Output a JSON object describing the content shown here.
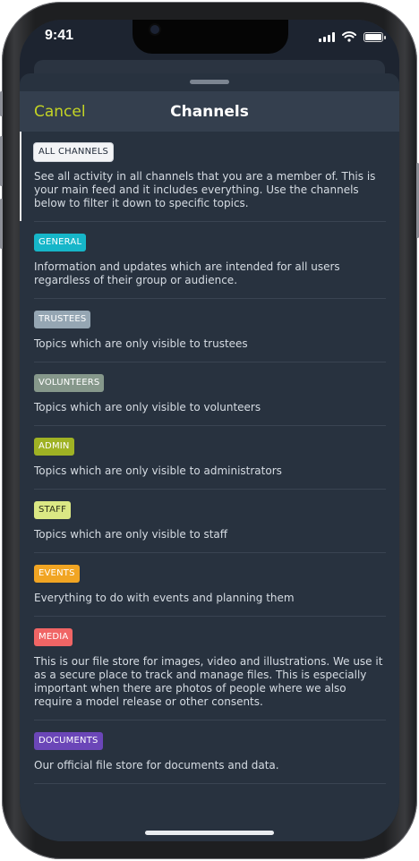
{
  "status": {
    "time": "9:41"
  },
  "header": {
    "cancel_label": "Cancel",
    "title": "Channels"
  },
  "channels": [
    {
      "tag": "ALL CHANNELS",
      "tag_bg": "#f3f4f6",
      "tag_fg": "#1f2937",
      "desc": "See all activity in all channels that you are a member of. This is your main feed and it includes everything. Use the channels below to filter it down to specific topics."
    },
    {
      "tag": "GENERAL",
      "tag_bg": "#16b6c9",
      "tag_fg": "#ffffff",
      "desc": "Information and updates which are intended for all users regardless of their group or audience."
    },
    {
      "tag": "TRUSTEES",
      "tag_bg": "#95a6b3",
      "tag_fg": "#ffffff",
      "desc": "Topics which are only visible to trustees"
    },
    {
      "tag": "VOLUNTEERS",
      "tag_bg": "#86988b",
      "tag_fg": "#ffffff",
      "desc": "Topics which are only visible to volunteers"
    },
    {
      "tag": "ADMIN",
      "tag_bg": "#9fb224",
      "tag_fg": "#ffffff",
      "desc": "Topics which are only visible to administrators"
    },
    {
      "tag": "STAFF",
      "tag_bg": "#dbe884",
      "tag_fg": "#2a2f1a",
      "desc": "Topics which are only visible to staff"
    },
    {
      "tag": "EVENTS",
      "tag_bg": "#f1a523",
      "tag_fg": "#ffffff",
      "desc": "Everything to do with events and planning them"
    },
    {
      "tag": "MEDIA",
      "tag_bg": "#f06565",
      "tag_fg": "#ffffff",
      "desc": "This is our file store for images, video and illustrations. We use it as a secure place to track and manage files. This is especially important when there are photos of people where we also require a model release or other consents."
    },
    {
      "tag": "DOCUMENTS",
      "tag_bg": "#6b46b8",
      "tag_fg": "#ffffff",
      "desc": "Our official file store for documents and data."
    }
  ],
  "icons": {
    "signal": "signal-icon",
    "wifi": "wifi-icon",
    "battery": "battery-icon"
  },
  "battery_level": 1.0
}
